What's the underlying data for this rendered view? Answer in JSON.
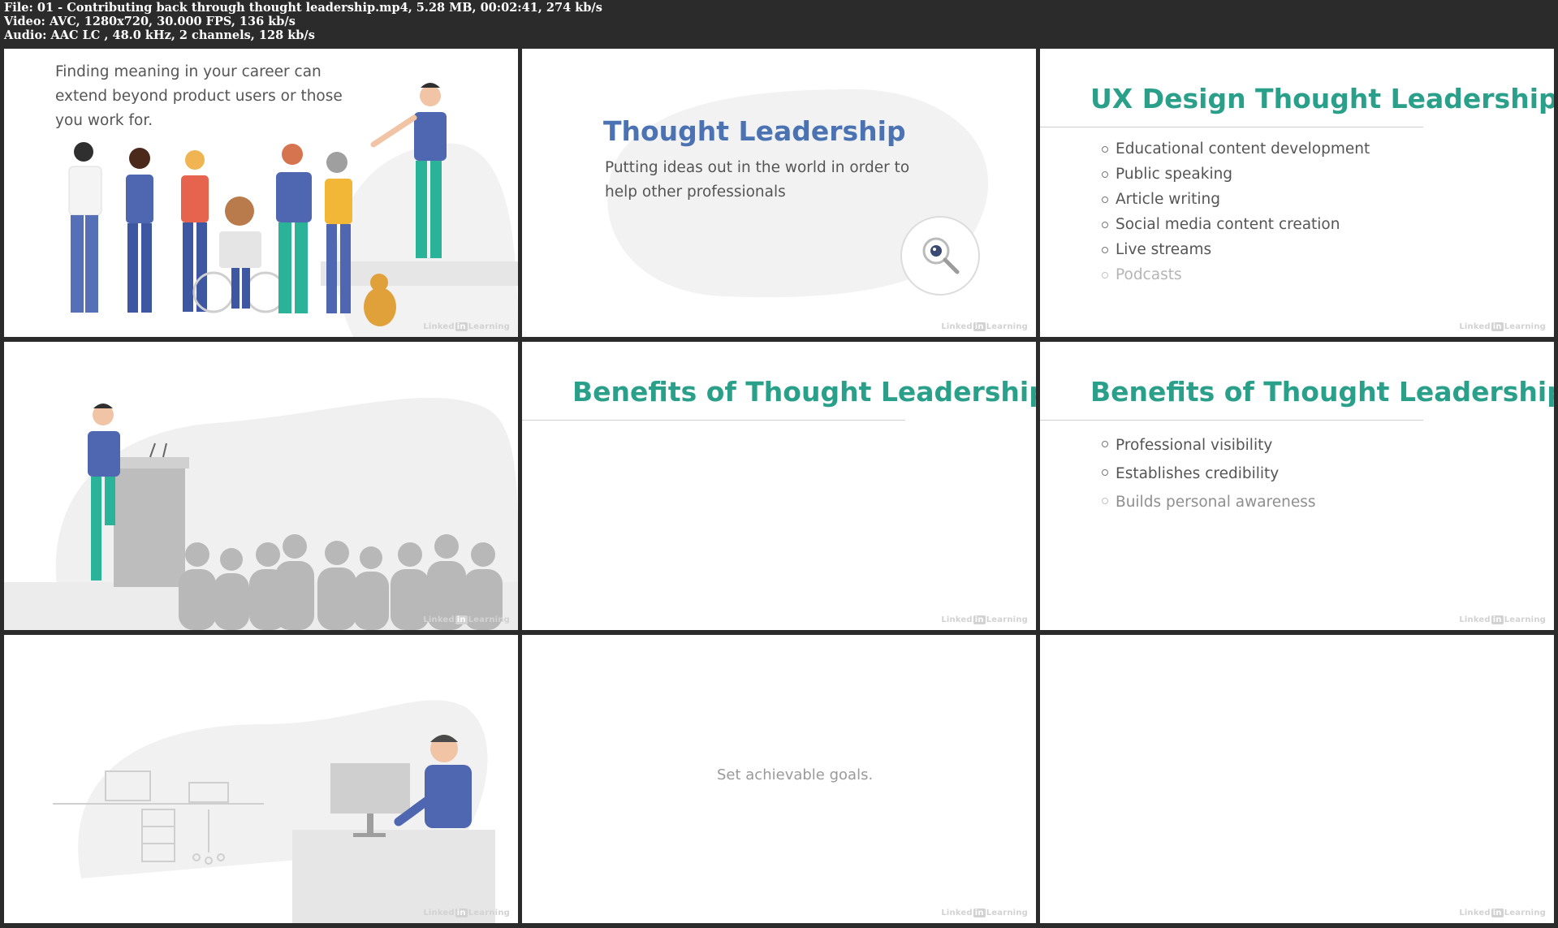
{
  "file_info": {
    "line1": "File: 01 - Contributing back through thought leadership.mp4, 5.28 MB, 00:02:41, 274 kb/s",
    "line2": "Video: AVC, 1280x720, 30.000 FPS, 136 kb/s",
    "line3": "Audio: AAC LC , 48.0 kHz, 2 channels, 128 kb/s"
  },
  "watermark": {
    "pre": "Linked",
    "in": "in",
    "post": "Learning"
  },
  "thumbs": {
    "t1": {
      "text": "Finding meaning in your career can extend beyond product users or those you work for."
    },
    "t2": {
      "title": "Thought Leadership",
      "body": "Putting ideas out in the world in order to help other professionals"
    },
    "t3": {
      "title": "UX Design Thought Leadership",
      "items": [
        "Educational content development",
        "Public speaking",
        "Article writing",
        "Social media content creation",
        "Live streams",
        "Podcasts"
      ]
    },
    "t5": {
      "title": "Benefits of Thought Leadership"
    },
    "t6": {
      "title": "Benefits of Thought Leadership",
      "items": [
        "Professional visibility",
        "Establishes credibility",
        "Builds personal awareness"
      ]
    },
    "t8": {
      "text": "Set achievable goals."
    }
  }
}
